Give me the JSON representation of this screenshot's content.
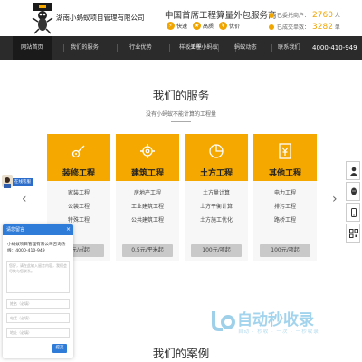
{
  "header": {
    "company_name": "湖南小蚂蚁项目管理有限公司",
    "slogan": "中国首席工程算量外包服务商",
    "badges": [
      {
        "label": "快速",
        "icon": "bolt-icon"
      },
      {
        "label": "高质",
        "icon": "medal-icon"
      },
      {
        "label": "优价",
        "icon": "yen-icon"
      }
    ],
    "stats": [
      {
        "label": "已委托商户：",
        "value": "2760",
        "unit": "人"
      },
      {
        "label": "已成交单数：",
        "value": "3282",
        "unit": "单"
      }
    ]
  },
  "nav": {
    "items": [
      "网站首页",
      "我们的服务",
      "行业优势",
      "样板工程",
      "关于小蚂蚁",
      "蚂蚁动态",
      "联系我们"
    ],
    "active_index": 0,
    "phone": "4000-410-949"
  },
  "services": {
    "title": "我们的服务",
    "subtitle": "没有小蚂蚁不能计算的工程量",
    "cards": [
      {
        "title": "装修工程",
        "icon": "brush-icon",
        "items": [
          "家装工程",
          "公装工程",
          "特殊工程"
        ],
        "price": "5元/㎡起"
      },
      {
        "title": "建筑工程",
        "icon": "gear-icon",
        "items": [
          "房地产工程",
          "工业建筑工程",
          "公共建筑工程"
        ],
        "price": "0.5元/平米起"
      },
      {
        "title": "土方工程",
        "icon": "pie-chart-icon",
        "items": [
          "土方量计算",
          "土方平衡计算",
          "土方施工优化"
        ],
        "price": "100元/项起"
      },
      {
        "title": "其他工程",
        "icon": "yen-icon",
        "items": [
          "电力工程",
          "排污工程",
          "路桥工程"
        ],
        "price": "100元/项起"
      }
    ]
  },
  "online_tag": "在线客服",
  "message_panel": {
    "header": "请您留言",
    "company": "小蚂蚁项目管理有限公司咨询热线：4000-410-949",
    "textarea_placeholder": "您好，请在此输入留言内容，我们会尽快与您联系。",
    "fields": [
      "姓名（必填）",
      "电话（必填）",
      "地址（必填）"
    ],
    "submit": "提交"
  },
  "cases": {
    "title": "我们的案例"
  },
  "watermark": {
    "text": "自动秒收录",
    "sub": "自动 · 秒收 · 一次 · 一秒收录"
  },
  "colors": {
    "accent": "#f5a800",
    "nav_bg": "#2b2b2b",
    "panel_blue": "#2f7bd8"
  }
}
